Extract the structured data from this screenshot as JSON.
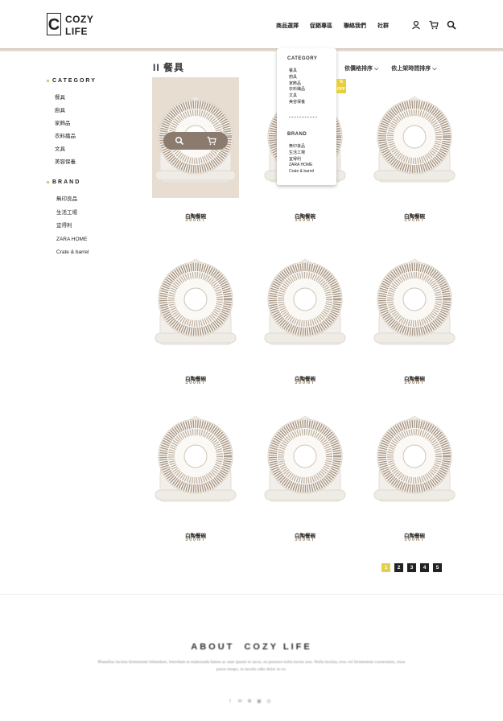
{
  "logo": {
    "letter": "C",
    "line1": "COZY",
    "line2": "LIFE"
  },
  "nav": {
    "items": [
      "商品選擇",
      "促銷專區",
      "聯絡我們",
      "社群"
    ],
    "icons": [
      "user-icon",
      "cart-icon",
      "search-icon"
    ]
  },
  "sidebar": {
    "category_title": "CATEGORY",
    "categories": [
      "餐具",
      "廚具",
      "家飾品",
      "衣料織品",
      "文具",
      "美容保養"
    ],
    "brand_title": "BRAND",
    "brands": [
      "無印良品",
      "生活工場",
      "宜得利",
      "ZARA HOME",
      "Crate & barrel"
    ]
  },
  "page": {
    "title": "II 餐具",
    "sort_price": "依價格排序 ⌵",
    "sort_date": "依上架時間排序 ⌵"
  },
  "dropdown": {
    "category_title": "CATEGORY",
    "categories": [
      "餐具",
      "廚具",
      "家飾品",
      "衣料織品",
      "文具",
      "美容保養"
    ],
    "separator": "-------------",
    "brand_title": "BRAND",
    "brands": [
      "無印良品",
      "生活工場",
      "宜得利",
      "ZARA HOME",
      "Crate & barrel"
    ]
  },
  "badge": {
    "text": "%\nOFF"
  },
  "products": [
    {
      "name": "白陶餐碗",
      "price": "300NT"
    },
    {
      "name": "白陶餐碗",
      "price": "300NT"
    },
    {
      "name": "白陶餐碗",
      "price": "300NT"
    },
    {
      "name": "白陶餐碗",
      "price": "300NT"
    },
    {
      "name": "白陶餐碗",
      "price": "300NT"
    },
    {
      "name": "白陶餐碗",
      "price": "300NT"
    },
    {
      "name": "白陶餐碗",
      "price": "300NT"
    },
    {
      "name": "白陶餐碗",
      "price": "300NT"
    },
    {
      "name": "白陶餐碗",
      "price": "300NT"
    }
  ],
  "pagination": {
    "pages": [
      "1",
      "2",
      "3",
      "4",
      "5"
    ],
    "active": "1"
  },
  "footer": {
    "about": "ABOUT  COZY LIFE",
    "lorem": "Phasellus lacinia fermentum bibendum. Interdum et malesuada fames ac ante ipsum in lacus, eu posuere nulla luctus non. Nulla lacinia, eros vel fermentum consectetur, risus purus tempc, et iaculis odio dolor in ex.",
    "social": [
      "f",
      "✉",
      "✿",
      "▣",
      "◎"
    ]
  },
  "colors": {
    "accent": "#e2cf4c",
    "brown": "#a08a72",
    "hover_bg": "#e8ddd1",
    "bar": "#8b7b6e"
  }
}
